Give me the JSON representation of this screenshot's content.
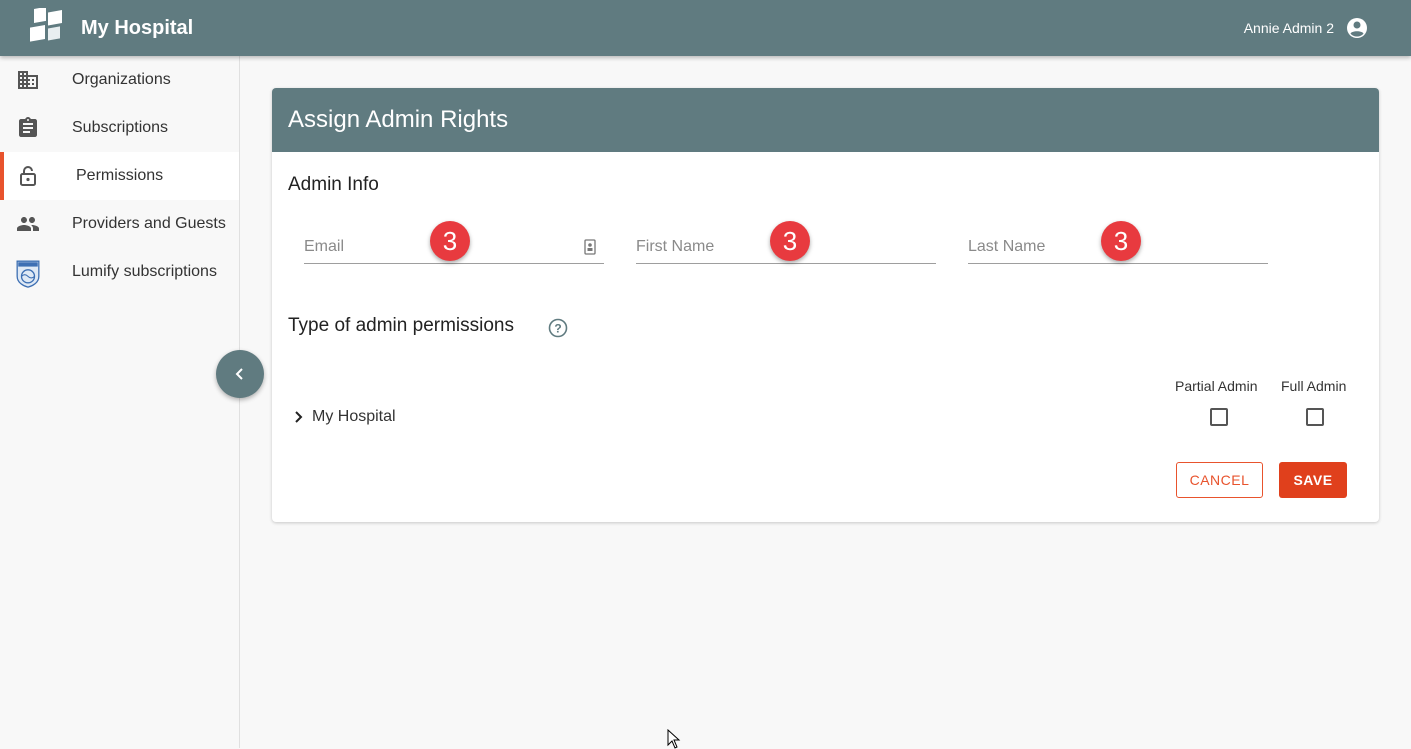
{
  "header": {
    "title": "My Hospital",
    "user_name": "Annie Admin 2",
    "logo_icon": "my-hospital-logo",
    "user_icon": "account-circle-icon"
  },
  "sidebar": {
    "items": [
      {
        "label": "Organizations",
        "icon": "building-icon",
        "active": false
      },
      {
        "label": "Subscriptions",
        "icon": "clipboard-icon",
        "active": false
      },
      {
        "label": "Permissions",
        "icon": "lock-icon",
        "active": true
      },
      {
        "label": "Providers and Guests",
        "icon": "people-icon",
        "active": false
      },
      {
        "label": "Lumify subscriptions",
        "icon": "philips-shield-icon",
        "active": false
      }
    ],
    "collapse_icon": "chevron-left-icon"
  },
  "card": {
    "title": "Assign Admin Rights",
    "admin_info_title": "Admin Info",
    "fields": {
      "email": {
        "placeholder": "Email",
        "value": "",
        "badge": "3"
      },
      "first_name": {
        "placeholder": "First Name",
        "value": "",
        "badge": "3"
      },
      "last_name": {
        "placeholder": "Last Name",
        "value": "",
        "badge": "3"
      }
    },
    "permissions_title": "Type of admin permissions",
    "columns": {
      "partial": "Partial Admin",
      "full": "Full Admin"
    },
    "tree": [
      {
        "label": "My Hospital",
        "expanded": false,
        "partial_admin": false,
        "full_admin": false
      }
    ],
    "buttons": {
      "cancel": "CANCEL",
      "save": "SAVE"
    }
  },
  "colors": {
    "header_bg": "#607b80",
    "accent": "#e8532d",
    "save_bg": "#e0401c",
    "badge_bg": "#e83a3f"
  }
}
